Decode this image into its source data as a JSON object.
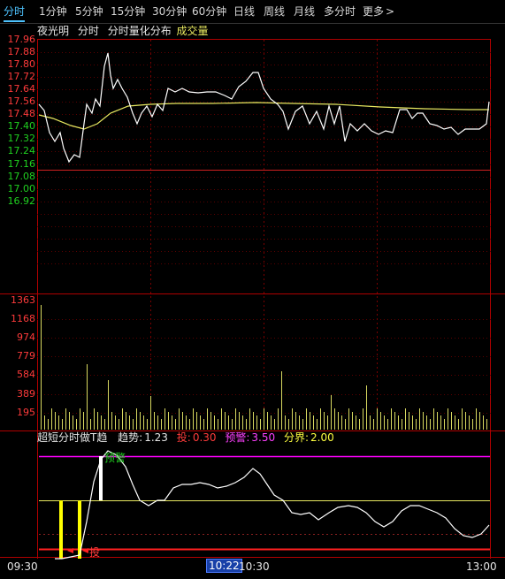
{
  "tabs": [
    "分时",
    "1分钟",
    "5分钟",
    "15分钟",
    "30分钟",
    "60分钟",
    "日线",
    "周线",
    "月线",
    "多分时",
    "更多"
  ],
  "more_glyph": ">",
  "legend": {
    "stock": "夜光明",
    "mode": "分时",
    "dist": "分时量化分布",
    "volume": "成交量"
  },
  "price_axis": [
    "17.96",
    "17.88",
    "17.80",
    "17.72",
    "17.64",
    "17.56",
    "17.48",
    "17.40",
    "17.32",
    "17.24",
    "17.16",
    "17.08",
    "17.00",
    "16.92"
  ],
  "volume_axis": [
    "1363",
    "1168",
    "974",
    "779",
    "584",
    "389",
    "195"
  ],
  "indicator": {
    "name": "超短分时做T趋",
    "trend_label": "趋势:",
    "trend_value": "1.23",
    "buy_label": "投:",
    "buy_value": "0.30",
    "warn_label": "预警:",
    "warn_value": "3.50",
    "divide_label": "分界:",
    "divide_value": "2.00",
    "mark_warn": "预警",
    "mark_buy": "投"
  },
  "times": {
    "open": "09:30",
    "cursor": "10:22",
    "mid": "10:30",
    "close": "13:00"
  },
  "colors": {
    "up": "#ff3b3b",
    "down": "#20d020",
    "price": "#ffffff",
    "avg": "#e8e860",
    "magenta": "#ff00ff",
    "yellow": "#ffff00"
  }
}
